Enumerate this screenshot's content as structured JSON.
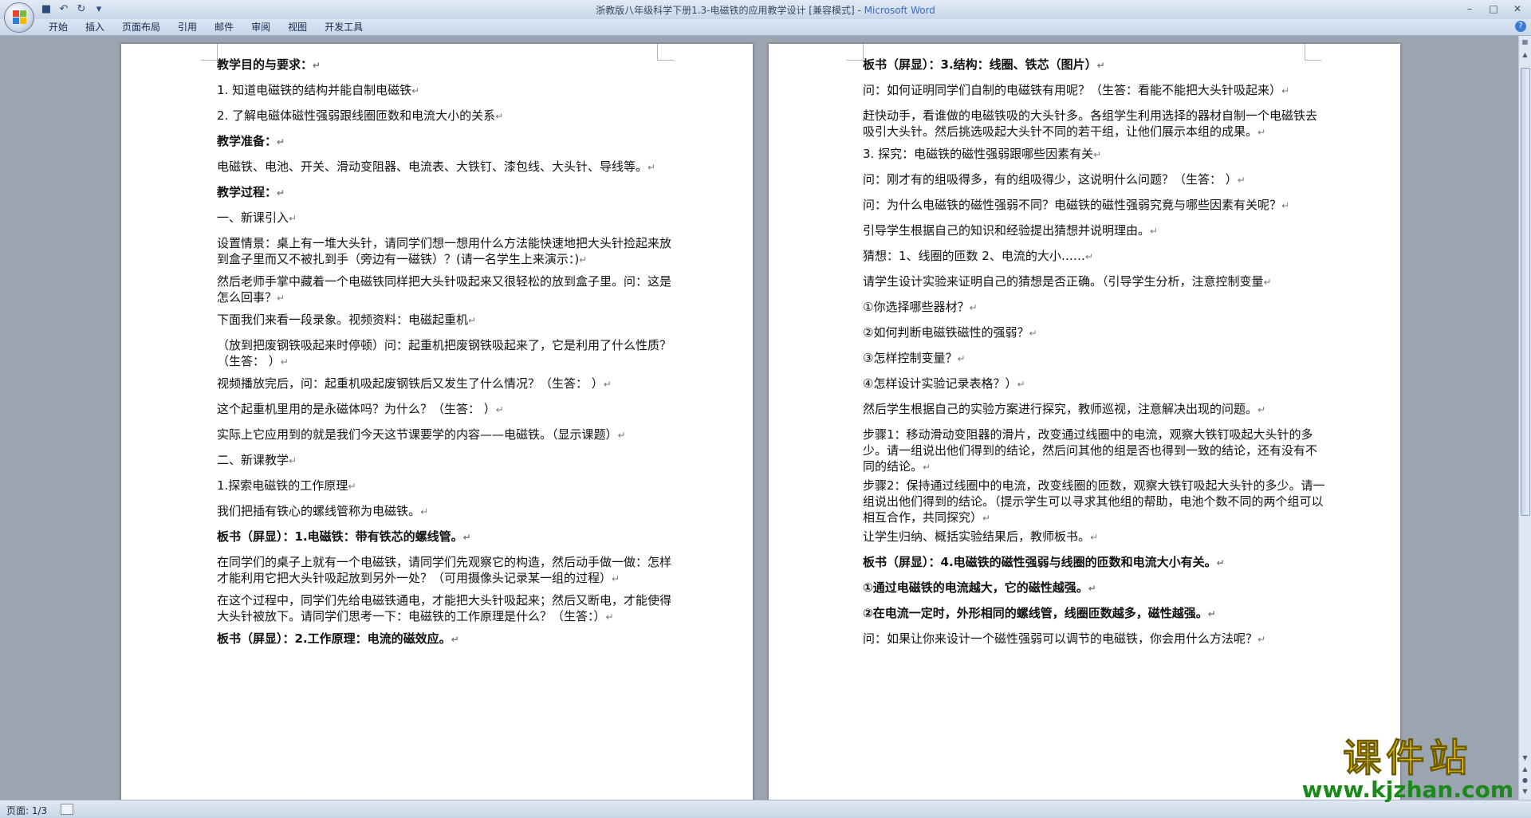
{
  "window": {
    "title": "浙教版八年级科学下册1.3-电磁铁的应用教学设计 [兼容模式]",
    "app_name": "Microsoft Word",
    "separator": " - "
  },
  "qat": {
    "save_icon": "save-icon",
    "undo_icon": "undo-icon",
    "redo_icon": "redo-icon",
    "customize_icon": "dropdown-icon"
  },
  "ribbon": {
    "tabs": [
      "开始",
      "插入",
      "页面布局",
      "引用",
      "邮件",
      "审阅",
      "视图",
      "开发工具"
    ]
  },
  "status": {
    "page": "页面: 1/3"
  },
  "paragraph_mark": "↵",
  "page1": [
    {
      "text": "教学目的与要求：",
      "bold": true
    },
    {
      "text": "1. 知道电磁铁的结构并能自制电磁铁",
      "bold": false
    },
    {
      "text": "2. 了解电磁体磁性强弱跟线圈匝数和电流大小的关系",
      "bold": false
    },
    {
      "text": "教学准备：",
      "bold": true
    },
    {
      "text": "电磁铁、电池、开关、滑动变阻器、电流表、大铁钉、漆包线、大头针、导线等。",
      "bold": false
    },
    {
      "text": "教学过程：",
      "bold": true
    },
    {
      "text": "一、新课引入",
      "bold": false
    },
    {
      "text": "设置情景：桌上有一堆大头针，请同学们想一想用什么方法能快速地把大头针捡起来放到盒子里而又不被扎到手（旁边有一磁铁）？(请一名学生上来演示：)",
      "bold": false
    },
    {
      "text": "然后老师手掌中藏着一个电磁铁同样把大头针吸起来又很轻松的放到盒子里。问：这是怎么回事？",
      "bold": false
    },
    {
      "text": "下面我们来看一段录象。视频资料：电磁起重机",
      "bold": false
    },
    {
      "text": "（放到把废钢铁吸起来时停顿）问：起重机把废钢铁吸起来了，它是利用了什么性质？（生答：  ）",
      "bold": false
    },
    {
      "text": "视频播放完后，问：起重机吸起废钢铁后又发生了什么情况？（生答：  ）",
      "bold": false
    },
    {
      "text": "这个起重机里用的是永磁体吗？为什么？（生答：  ）",
      "bold": false
    },
    {
      "text": "实际上它应用到的就是我们今天这节课要学的内容——电磁铁。（显示课题）",
      "bold": false
    },
    {
      "text": "二、新课教学",
      "bold": false
    },
    {
      "text": "1.探索电磁铁的工作原理",
      "bold": false
    },
    {
      "text": "我们把插有铁心的螺线管称为电磁铁。",
      "bold": false
    },
    {
      "text": "板书（屏显）：1.电磁铁：带有铁芯的螺线管。",
      "bold": true
    },
    {
      "text": "在同学们的桌子上就有一个电磁铁，请同学们先观察它的构造，然后动手做一做：怎样才能利用它把大头针吸起放到另外一处？（可用摄像头记录某一组的过程）",
      "bold": false
    },
    {
      "text": "在这个过程中，同学们先给电磁铁通电，才能把大头针吸起来；然后又断电，才能使得大头针被放下。请同学们思考一下：电磁铁的工作原理是什么？（生答：）",
      "bold": false
    },
    {
      "text": "板书（屏显）：2.工作原理：电流的磁效应。",
      "bold": true
    }
  ],
  "page2": [
    {
      "text": "板书（屏显）：3.结构：线圈、铁芯（图片）",
      "bold": true
    },
    {
      "text": "问：如何证明同学们自制的电磁铁有用呢？（生答：看能不能把大头针吸起来）",
      "bold": false
    },
    {
      "text": "赶快动手，看谁做的电磁铁吸的大头针多。各组学生利用选择的器材自制一个电磁铁去吸引大头针。然后挑选吸起大头针不同的若干组，让他们展示本组的成果。",
      "bold": false
    },
    {
      "text": "3. 探究：电磁铁的磁性强弱跟哪些因素有关",
      "bold": false
    },
    {
      "text": "问：刚才有的组吸得多，有的组吸得少，这说明什么问题？（生答：  ）",
      "bold": false
    },
    {
      "text": "问：为什么电磁铁的磁性强弱不同？电磁铁的磁性强弱究竟与哪些因素有关呢？",
      "bold": false
    },
    {
      "text": "引导学生根据自己的知识和经验提出猜想并说明理由。",
      "bold": false
    },
    {
      "text": "猜想：1、线圈的匝数 2、电流的大小……",
      "bold": false
    },
    {
      "text": "请学生设计实验来证明自己的猜想是否正确。（引导学生分析，注意控制变量",
      "bold": false
    },
    {
      "text": "①你选择哪些器材？",
      "bold": false
    },
    {
      "text": "②如何判断电磁铁磁性的强弱？",
      "bold": false
    },
    {
      "text": "③怎样控制变量？",
      "bold": false
    },
    {
      "text": "④怎样设计实验记录表格？）",
      "bold": false
    },
    {
      "text": "然后学生根据自己的实验方案进行探究，教师巡视，注意解决出现的问题。",
      "bold": false
    },
    {
      "text": "步骤1：移动滑动变阻器的滑片，改变通过线圈中的电流，观察大铁钉吸起大头针的多少。请一组说出他们得到的结论，然后问其他的组是否也得到一致的结论，还有没有不同的结论。",
      "bold": false
    },
    {
      "text": "步骤2：保持通过线圈中的电流，改变线圈的匝数，观察大铁钉吸起大头针的多少。请一组说出他们得到的结论。（提示学生可以寻求其他组的帮助，电池个数不同的两个组可以相互合作，共同探究）",
      "bold": false
    },
    {
      "text": "让学生归纳、概括实验结果后，教师板书。",
      "bold": false
    },
    {
      "text": "板书（屏显）：4.电磁铁的磁性强弱与线圈的匝数和电流大小有关。",
      "bold": true
    },
    {
      "text": "①通过电磁铁的电流越大，它的磁性越强。",
      "bold": true
    },
    {
      "text": "②在电流一定时，外形相同的螺线管，线圈匝数越多，磁性越强。",
      "bold": true
    },
    {
      "text": "问：如果让你来设计一个磁性强弱可以调节的电磁铁，你会用什么方法呢？",
      "bold": false
    }
  ],
  "watermark": {
    "text": "课件站",
    "url": "www.kjzhan.com"
  }
}
